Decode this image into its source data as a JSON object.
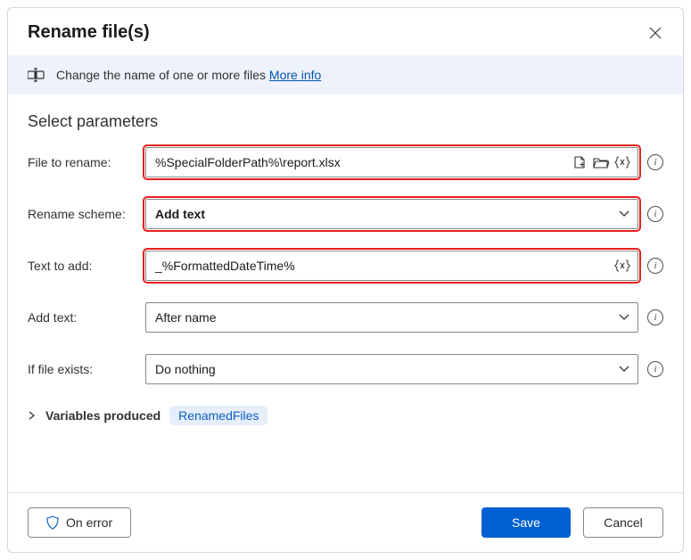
{
  "header": {
    "title": "Rename file(s)"
  },
  "banner": {
    "text": "Change the name of one or more files ",
    "link_label": "More info"
  },
  "section_title": "Select parameters",
  "fields": {
    "file_to_rename": {
      "label": "File to rename:",
      "value": "%SpecialFolderPath%\\report.xlsx"
    },
    "rename_scheme": {
      "label": "Rename scheme:",
      "value": "Add text"
    },
    "text_to_add": {
      "label": "Text to add:",
      "value": "_%FormattedDateTime%"
    },
    "add_text": {
      "label": "Add text:",
      "value": "After name"
    },
    "if_file_exists": {
      "label": "If file exists:",
      "value": "Do nothing"
    }
  },
  "variables": {
    "label": "Variables produced",
    "chip": "RenamedFiles"
  },
  "footer": {
    "on_error": "On error",
    "save": "Save",
    "cancel": "Cancel"
  }
}
